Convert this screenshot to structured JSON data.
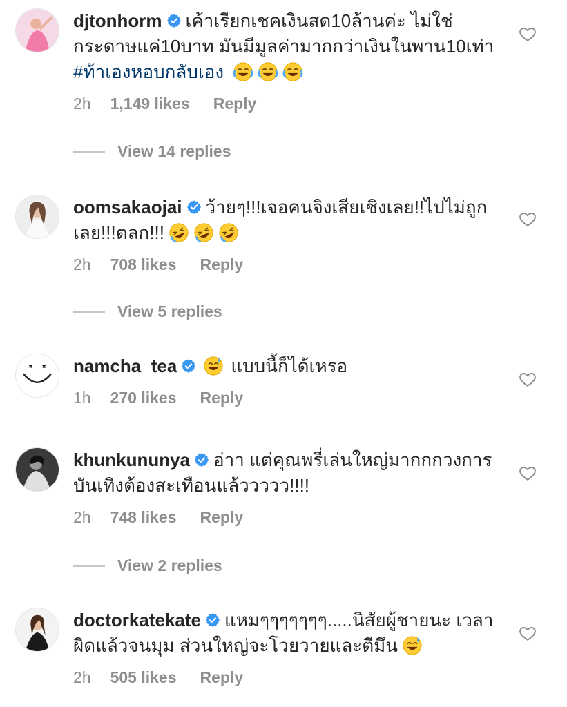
{
  "comments": [
    {
      "username": "djtonhorm",
      "text": "เค้าเรียกเชคเงินสด10ล้านค่ะ ไม่ใช่กระดาษแค่10บาท มันมีมูลค่ามากกว่าเงินในพาน10เท่า",
      "hashtag": "#ท้าเองหอบกลับเอง",
      "emoji": "joy-emoji x3",
      "time": "2h",
      "likes": "1,149 likes",
      "reply": "Reply",
      "view_replies": "View 14 replies"
    },
    {
      "username": "oomsakaojai",
      "text": "ว้ายๆ!!!เจอคนจิงเสียเชิงเลย!!ไปไม่ถูกเลย!!!ตลก!!!",
      "emoji": "rofl-emoji x3",
      "time": "2h",
      "likes": "708 likes",
      "reply": "Reply",
      "view_replies": "View 5 replies"
    },
    {
      "username": "namcha_tea",
      "text": "แบบนี้ก็ได้เหรอ",
      "emoji": "sweat-smile-emoji",
      "time": "1h",
      "likes": "270 likes",
      "reply": "Reply"
    },
    {
      "username": "khunkununya",
      "text": "อ่าา แต่คุณพรี่เล่นใหญ่มากกกวงการบันเทิงต้องสะเทือนแล้ววววว!!!!",
      "time": "2h",
      "likes": "748 likes",
      "reply": "Reply",
      "view_replies": "View 2 replies"
    },
    {
      "username": "doctorkatekate",
      "text": "แหมๆๆๆๆๆๆๆ.....นิสัยผู้ชายนะ เวลาผิดแล้วจนมุม ส่วนใหญ่จะโวยวายและตีมึน",
      "emoji": "sweat-smile-emoji",
      "time": "2h",
      "likes": "505 likes",
      "reply": "Reply"
    }
  ],
  "colors": {
    "text": "#262626",
    "muted": "#8e8e8e",
    "hashtag": "#00376b",
    "verified": "#3897f0"
  }
}
